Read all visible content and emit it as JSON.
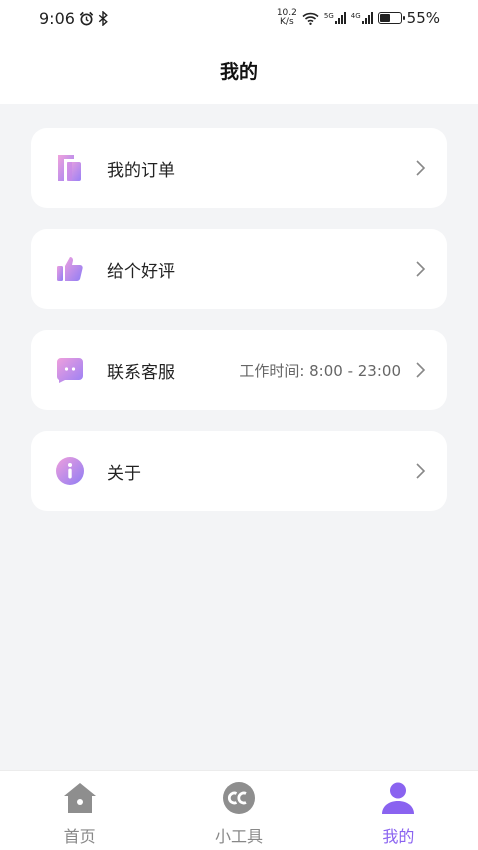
{
  "status_bar": {
    "time": "9:06",
    "net_speed_value": "10.2",
    "net_speed_unit": "K/s",
    "sig1_tag": "5G",
    "sig2_tag": "4G",
    "battery_level": 0.55,
    "battery_text": "55%"
  },
  "header": {
    "title": "我的"
  },
  "menu": {
    "orders": {
      "label": "我的订单",
      "icon": "orders-icon"
    },
    "rate": {
      "label": "给个好评",
      "icon": "thumbs-up-icon"
    },
    "support": {
      "label": "联系客服",
      "extra": "工作时间: 8:00 - 23:00",
      "icon": "chat-icon"
    },
    "about": {
      "label": "关于",
      "icon": "info-icon"
    }
  },
  "tab_bar": {
    "tabs": [
      {
        "label": "首页",
        "icon": "home-icon"
      },
      {
        "label": "小工具",
        "icon": "cc-icon"
      },
      {
        "label": "我的",
        "icon": "user-icon",
        "active": true
      }
    ]
  },
  "colors": {
    "accent": "#8a63f0",
    "gradient_start": "#e79be0",
    "gradient_end": "#8f7df4",
    "background": "#f3f4f6"
  }
}
